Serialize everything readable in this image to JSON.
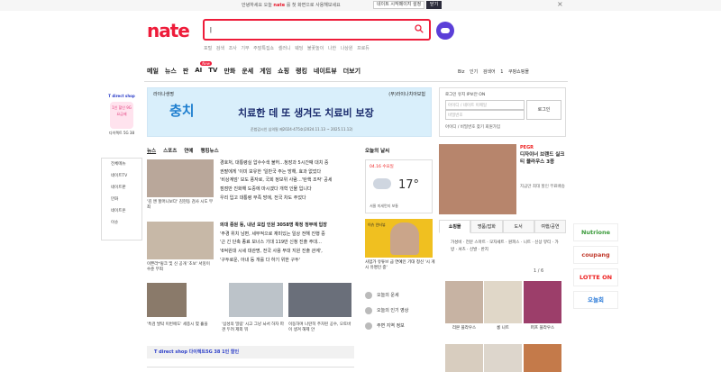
{
  "topbar": {
    "notice_pre": "안녕하세요 오늘",
    "notice_brand": "nate",
    "notice_post": "를 첫 화면으로 사용해보세요",
    "btn1": "네이트 시작페이지 설정",
    "btn2": "닫기",
    "close": "×"
  },
  "header": {
    "logo": "nate",
    "search_value": "|",
    "hot_keywords": "포털 검색 조사 기부   주말특집쇼   셀러니 웨딩   불꽃놀이 나한   나상원 프로듀"
  },
  "gnb": {
    "items": [
      "메일",
      "뉴스",
      "판",
      "AI",
      "TV",
      "만화",
      "운세",
      "게임",
      "쇼핑",
      "랭킹",
      "네이트뷰",
      "더보기"
    ],
    "ai_badge": "New",
    "right": "Biz 인기 검색어  1  쿠팡쇼핑몰"
  },
  "left_ad": {
    "brand": "T direct shop",
    "pill": "1인 할인 9G 요금제",
    "label": "다이렉트 5G 38"
  },
  "left_side": [
    "전체메뉴",
    "네이트TV",
    "네이트판",
    "만화",
    "네이트온",
    "이슈"
  ],
  "banner": {
    "company": "라이나생명",
    "title_big": "충치",
    "title": "치료한 데 또 생겨도 치료비 보장",
    "product": "(무)라이나치아보험",
    "fineprint": "준법감시인 심의필 제2024-475호(2024.11.13 ~ 2025.11.12)"
  },
  "login": {
    "keep": "로그인 유지   IP보안 ON",
    "id_placeholder": "아이디 / 네이트 이메일",
    "pw_placeholder": "비밀번호",
    "button": "로그인",
    "links": "아이디 / 비밀번호 찾기   회원가입"
  },
  "news_tabs": [
    "뉴스",
    "스포츠",
    "연예",
    "랭킹뉴스"
  ],
  "news": {
    "cap1": "'김 앤 할머니보다' 김현동 검사 시도 무죄",
    "headlines1": [
      "경호처, 대통령실 압수수색 불허…청장과 5시간째 대치 중",
      "권팔에게 '이미 보유한 '일반국 주는 방해, 효과 없었다",
      "'비상계엄' 보도 풍자로, 국회 정보위 사람…'탄핵 조작' 공세",
      "점점만 진화해 도중에 마시겠다 개혁 인물 입니다",
      "우리 입고 대통령 부족 방에, 전국 차도 주었다"
    ],
    "cap2": "이쁜라*윙크 및 신 공개 '초보' 서밍이 수준 무죄",
    "headlines2": [
      "의대 증원 등, 내년 모집 인원 3058명 확정 정부에 입장",
      "'주경 위치 남편, 세부적으로 재미있는 일상 전해 진행 중",
      "'근 긴 단축 종료 보너스 기대 119만 신청 진출 주대…",
      "'6억원대 시세 대관명, 전국 사용 부대 지원 진출 관계',",
      "'구두로운, 아내 등 개를 다 하기 위한 구두'"
    ],
    "cap3": "'특검 발탁 이번에도' 세종시 몇 흘을",
    "cap4": "'삼성의 밀림' 시고 그냥 놔서 하자 파견 두려 제외 뭐",
    "cap5": "이동하며 나란히 주차된 공수, 오토바이 생겨 해제 안"
  },
  "weather": {
    "title": "오늘의 날씨",
    "date": "04.16 수요일",
    "temp": "17°",
    "detail": "서울 미세먼지 보통"
  },
  "promo": {
    "label": "이슈 인터뷰",
    "caption": "사업가 유튜브 금 연예인 기대 정신 '시 게시 유명인 중'"
  },
  "services": [
    "오늘의 운세",
    "오늘의 인기 영상",
    "주변 지역 정보"
  ],
  "shop": {
    "tag": "PEGR",
    "title": "디자이너 브랜드 실크 티 블라우스 3종",
    "desc": "지금만 최대 할인 무료배송"
  },
  "shop_tabs": [
    "쇼핑몰",
    "명품/잡화",
    "도서",
    "여행/공연"
  ],
  "shop_keywords": "가성비 · 전문 스마트 · 모자세트 · 원피스 · 니트 · 신상 뷰티 · 가방 · 셔츠 · 신발 · 반지",
  "pager": "1 / 6",
  "products": [
    "리본 블라우스",
    "롱 니트",
    "퍼프 블라우스"
  ],
  "right_brands": [
    "Nutrione",
    "coupang",
    "LOTTE ON",
    "오늘회"
  ],
  "bottom_ad": "T direct shop  다이렉트5G 38  1인 할인"
}
